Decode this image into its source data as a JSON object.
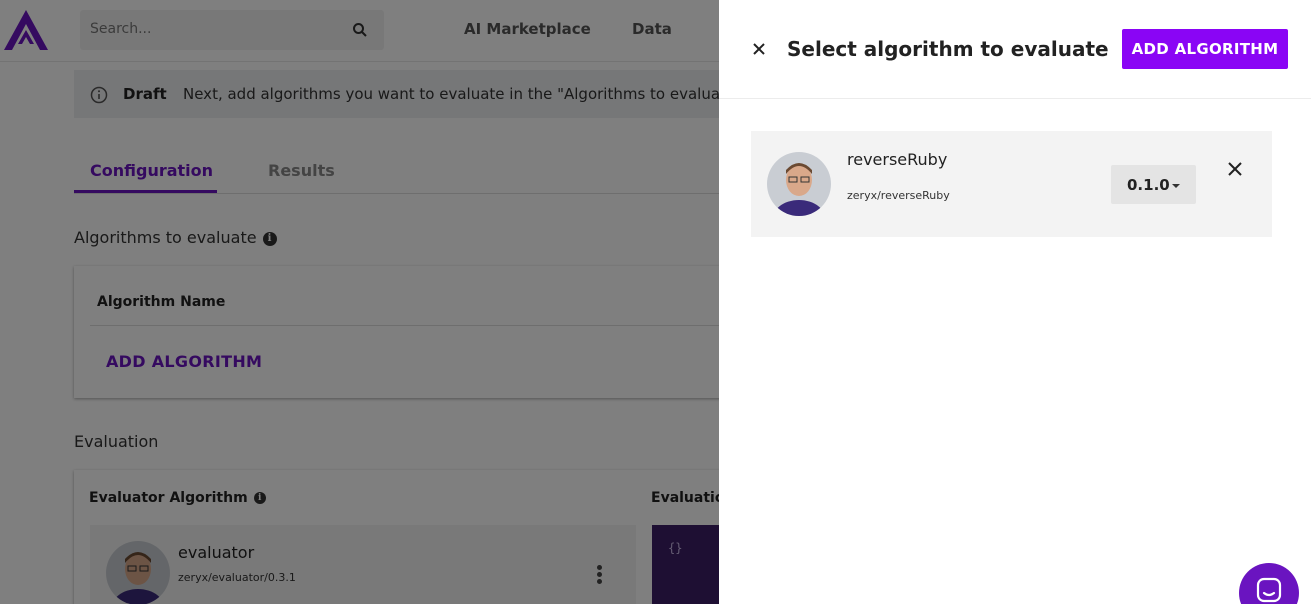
{
  "header": {
    "search_placeholder": "Search...",
    "nav": [
      "AI Marketplace",
      "Data"
    ]
  },
  "banner": {
    "title": "Draft",
    "text": "Next, add algorithms you want to evaluate in the \"Algorithms to evaluate\" section."
  },
  "tabs": [
    {
      "label": "Configuration",
      "active": true
    },
    {
      "label": "Results",
      "active": false
    }
  ],
  "algorithms_section": {
    "title": "Algorithms to evaluate",
    "column_header": "Algorithm Name",
    "add_label": "ADD ALGORITHM"
  },
  "evaluation_section": {
    "title": "Evaluation",
    "evaluator_label": "Evaluator Algorithm",
    "evaluation_label": "Evaluation",
    "evaluator": {
      "name": "evaluator",
      "path": "zeryx/evaluator/0.3.1"
    },
    "code_preview": "{}"
  },
  "drawer": {
    "title": "Select algorithm to evaluate",
    "add_button": "ADD ALGORITHM",
    "selected": [
      {
        "name": "reverseRuby",
        "path": "zeryx/reverseRuby",
        "version": "0.1.0"
      }
    ]
  },
  "colors": {
    "accent": "#8a05f5",
    "brand": "#6a14c0"
  },
  "icons": {
    "search": "search-icon",
    "info": "info-icon",
    "close": "close-icon",
    "chat": "chat-icon"
  }
}
